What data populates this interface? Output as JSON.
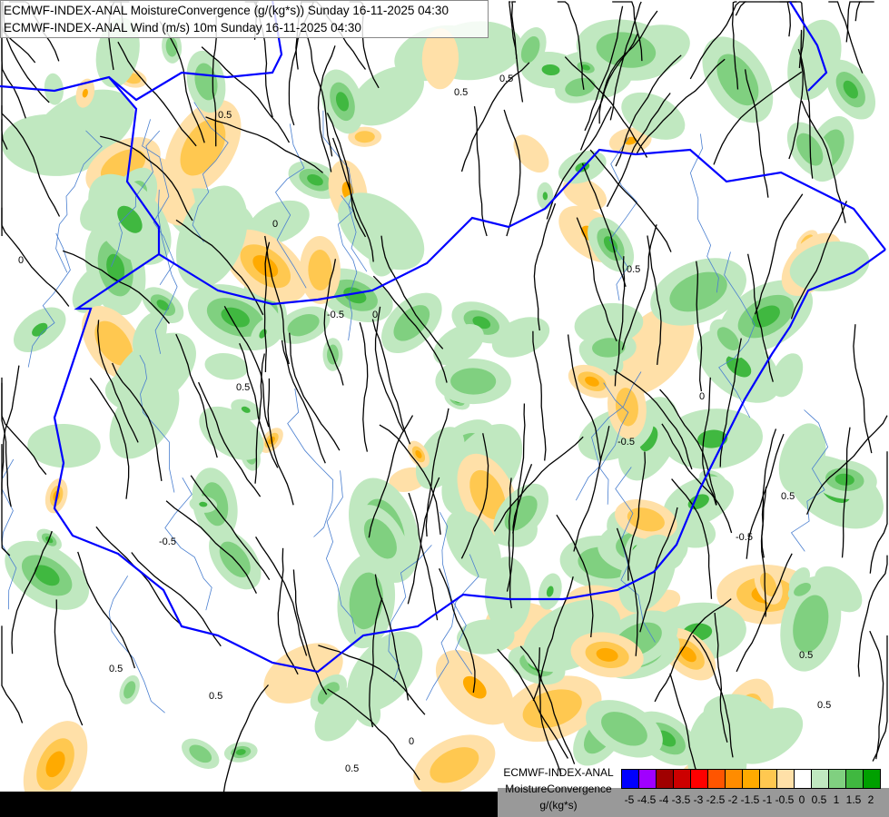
{
  "header": {
    "line1": "ECMWF-INDEX-ANAL MoistureConvergence (g/(kg*s)) Sunday 16-11-2025 04:30",
    "line2": "ECMWF-INDEX-ANAL Wind (m/s) 10m Sunday 16-11-2025 04:30"
  },
  "legend": {
    "model": "ECMWF-INDEX-ANAL",
    "parameter": "MoistureConvergence",
    "unit": "g/(kg*s)",
    "colors": [
      "#0000ff",
      "#a000ff",
      "#a00000",
      "#cc0000",
      "#ff0000",
      "#ff5500",
      "#ff8c00",
      "#ffaa00",
      "#ffc850",
      "#ffe0a8",
      "#ffffff",
      "#c0e8c0",
      "#80d080",
      "#40b840",
      "#00a000"
    ],
    "ticks": [
      "-5",
      "-4.5",
      "-4",
      "-3.5",
      "-3",
      "-2.5",
      "-2",
      "-1.5",
      "-1",
      "-0.5",
      "0",
      "0.5",
      "1",
      "1.5",
      "2"
    ]
  },
  "map": {
    "contour_labels": [
      "0.5",
      "0",
      "-0.5",
      "0.5",
      "0",
      "0.5",
      "-0.5",
      "0",
      "0.5",
      "0.5",
      "-0.5",
      "0.5",
      "0",
      "0.5",
      "-0.5",
      "0.5",
      "0.5",
      "0",
      "0.5",
      "0.5"
    ],
    "border_color": "#0000ff",
    "river_color": "#4a7fd0"
  }
}
